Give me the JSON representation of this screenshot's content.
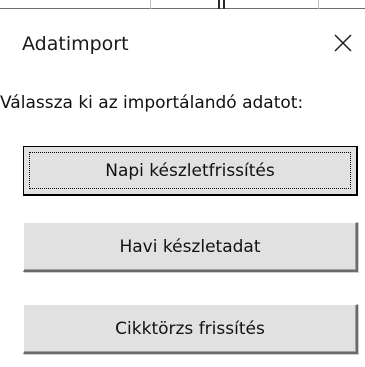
{
  "dialog": {
    "title": "Adatimport",
    "close_icon": "close-icon"
  },
  "prompt": {
    "text": "Válassza ki az importálandó adatot:"
  },
  "buttons": [
    {
      "label": "Napi készletfrissítés",
      "focused": true
    },
    {
      "label": "Havi készletadat",
      "focused": false
    },
    {
      "label": "Cikktörzs frissítés",
      "focused": false
    }
  ],
  "colors": {
    "button_face": "#e1e1e1",
    "text": "#111111"
  }
}
